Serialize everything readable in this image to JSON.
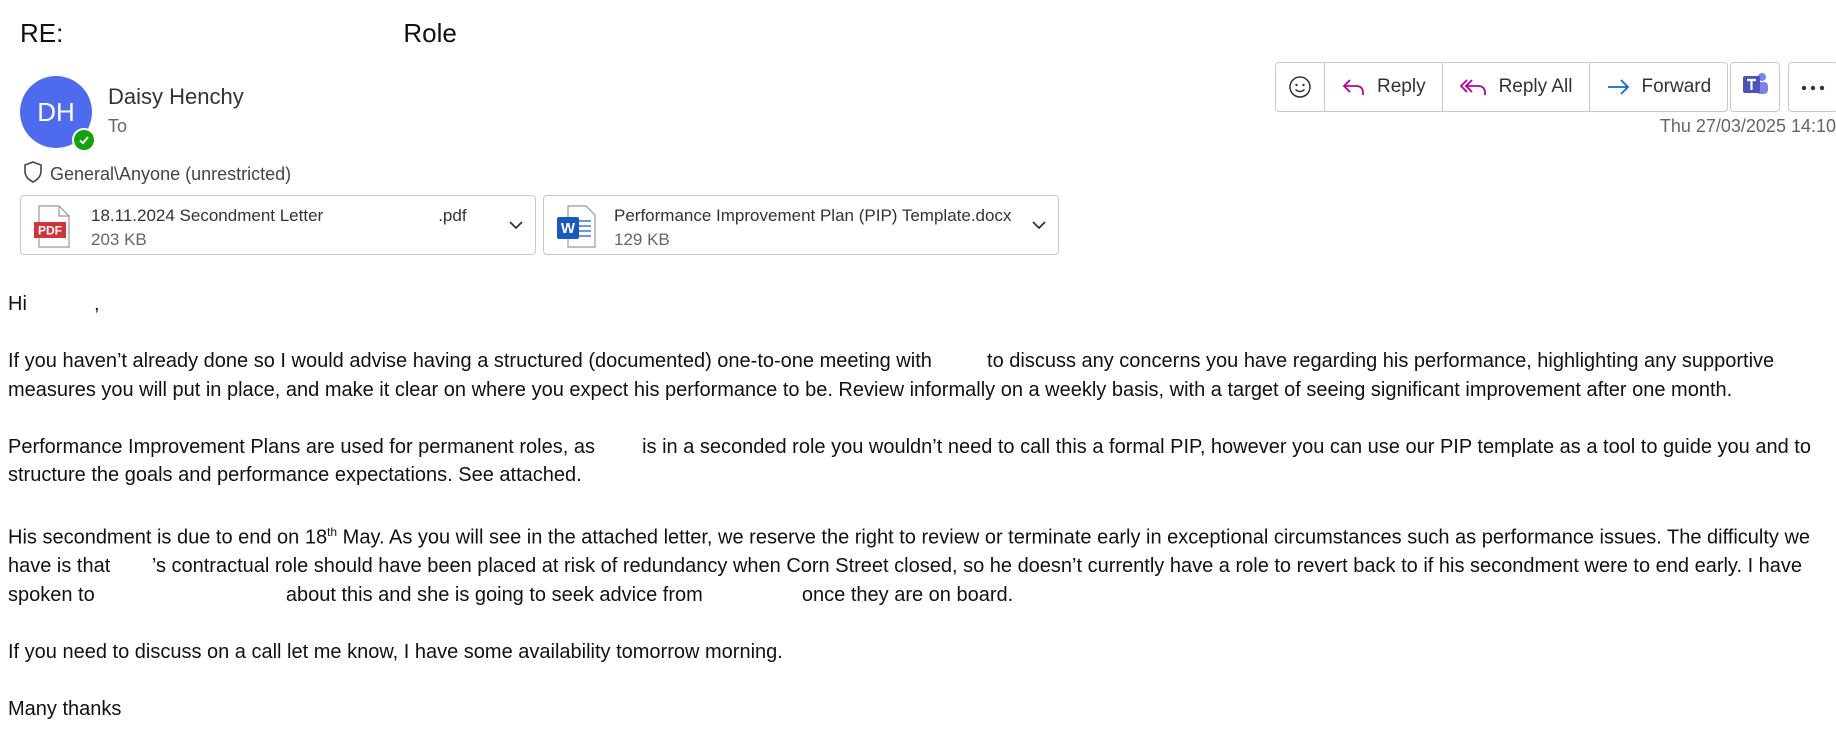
{
  "email": {
    "subject_prefix": "RE:",
    "subject_suffix": "Role",
    "sender": {
      "initials": "DH",
      "name": "Daisy Henchy"
    },
    "to_label": "To",
    "timestamp": "Thu 27/03/2025 14:10",
    "sensitivity_label": "General\\Anyone (unrestricted)"
  },
  "toolbar": {
    "reply_label": "Reply",
    "reply_all_label": "Reply All",
    "forward_label": "Forward"
  },
  "attachments": [
    {
      "name_start": "18.11.2024 Secondment Letter",
      "name_ext": ".pdf",
      "size": "203 KB",
      "type_label": "PDF"
    },
    {
      "name": "Performance Improvement Plan (PIP) Template.docx",
      "size": "129 KB",
      "type_label": "W"
    }
  ],
  "body": {
    "greeting_start": "Hi",
    "greeting_end": ",",
    "p1_a": "If you haven’t already done so I would advise having a structured (documented) one-to-one meeting with",
    "p1_b": "to discuss any concerns you have regarding his performance, highlighting any supportive measures you will put in place, and make it clear on where you expect his performance to be. Review informally on a weekly basis, with a target of seeing significant improvement after one month.",
    "p2_a": "Performance Improvement Plans are used for permanent roles, as",
    "p2_b": "is in a seconded role you wouldn’t need to call this a formal PIP, however you can use our PIP template as a tool to guide you and to structure the goals and performance expectations. See attached.",
    "p3_a": "His secondment is due to end on 18",
    "p3_sup": "th",
    "p3_b": " May. As you will see in the attached letter, we reserve the right to review or terminate early in exceptional circumstances such as performance issues. The difficulty we have is that",
    "p3_c": "’s contractual role should have been placed at risk of redundancy when Corn Street closed, so he doesn’t currently have a role to revert back to if his secondment were to end early. I have spoken to",
    "p3_d": "about this and she is going to seek advice from",
    "p3_e": "once they are on board.",
    "p4": "If you need to discuss on a call let me know, I have some availability tomorrow morning.",
    "signoff": "Many thanks"
  },
  "colors": {
    "avatar": "#4f6bed",
    "presence": "#13a10e",
    "reply_icon": "#b4009e",
    "forward_icon": "#0f6cbd",
    "pdf": "#d13438",
    "word": "#185abd"
  }
}
